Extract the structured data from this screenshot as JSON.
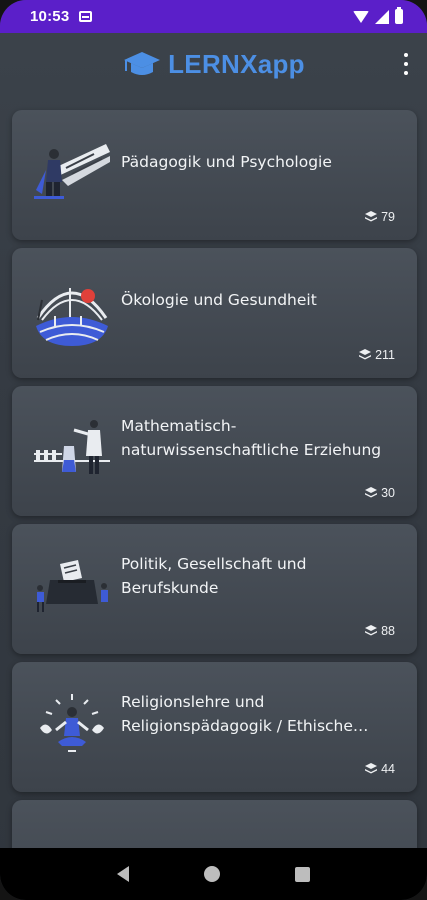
{
  "status_bar": {
    "time": "10:53",
    "icons": [
      "calendar-icon",
      "wifi-icon",
      "signal-icon",
      "battery-icon"
    ]
  },
  "app_bar": {
    "title": "LERNXapp",
    "logo_icon": "graduation-cap-icon",
    "menu_icon": "more-vert-icon"
  },
  "colors": {
    "status_bar": "#5b1fc9",
    "brand_blue": "#4c8fe4",
    "background": "#353b43",
    "card": "#454c55"
  },
  "categories": [
    {
      "title": "Pädagogik und Psychologie",
      "count": "79",
      "illustration": "teacher-board-illustration"
    },
    {
      "title": "Ökologie und Gesundheit",
      "count": "211",
      "illustration": "earth-tree-illustration"
    },
    {
      "title": "Mathematisch-naturwissenschaftliche Erziehung",
      "count": "30",
      "illustration": "scientist-lab-illustration"
    },
    {
      "title": "Politik, Gesellschaft und Berufskunde",
      "count": "88",
      "illustration": "ballot-box-illustration"
    },
    {
      "title": "Religionslehre und Religionspädagogik / Ethische Erziehung",
      "count": "44",
      "illustration": "meditation-person-illustration"
    }
  ],
  "count_icon": "layers-icon",
  "nav_bar": {
    "icons": [
      "back-icon",
      "home-icon",
      "recents-icon"
    ]
  }
}
